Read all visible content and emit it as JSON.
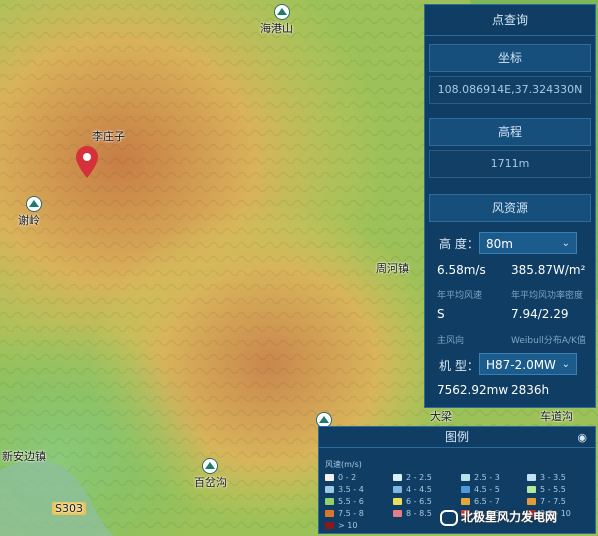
{
  "map": {
    "labels": [
      "海港山",
      "李庄子",
      "谢岭",
      "周河镇",
      "大梁",
      "车道沟",
      "百岔沟",
      "新安边镇",
      "S303"
    ]
  },
  "panel": {
    "title": "点查询",
    "coord_label": "坐标",
    "coord_value": "108.086914E,37.324330N",
    "elev_label": "高程",
    "elev_value": "1711m",
    "wind_label": "风资源",
    "height_label": "高 度：",
    "height_value": "80m",
    "wind_speed": "6.58m/s",
    "wind_speed_note": "年平均风速",
    "power_density": "385.87W/m²",
    "power_density_note": "年平均风功率密度",
    "direction": "S",
    "direction_note": "主风向",
    "weibull": "7.94/2.29",
    "weibull_note": "Weibull分布A/K值",
    "model_label": "机 型：",
    "model_value": "H87-2.0MW",
    "energy": "7562.92mw",
    "hours": "2836h"
  },
  "legend": {
    "title": "图例",
    "unit": "风速(m/s)",
    "items": [
      {
        "label": "0 - 2",
        "color": "#f2f2f2"
      },
      {
        "label": "2 - 2.5",
        "color": "#d9f0f5"
      },
      {
        "label": "2.5 - 3",
        "color": "#b7e1ee"
      },
      {
        "label": "3 - 3.5",
        "color": "#c5e2f0"
      },
      {
        "label": "3.5 - 4",
        "color": "#9cc9e6"
      },
      {
        "label": "4 - 4.5",
        "color": "#7fb7e2"
      },
      {
        "label": "4.5 - 5",
        "color": "#4f9ad8"
      },
      {
        "label": "5 - 5.5",
        "color": "#b6e89a"
      },
      {
        "label": "5.5 - 6",
        "color": "#8fd36a"
      },
      {
        "label": "6 - 6.5",
        "color": "#e8e05c"
      },
      {
        "label": "6.5 - 7",
        "color": "#e2a83c"
      },
      {
        "label": "7 - 7.5",
        "color": "#e59a3a"
      },
      {
        "label": "7.5 - 8",
        "color": "#d9772e"
      },
      {
        "label": "8 - 8.5",
        "color": "#e07f8a"
      },
      {
        "label": "9 - 9.5",
        "color": "#cf4a4a"
      },
      {
        "label": "9.5 - 10",
        "color": "#b23030"
      },
      {
        "label": "> 10",
        "color": "#8a1a1a"
      }
    ]
  },
  "watermark": "北极星风力发电网"
}
